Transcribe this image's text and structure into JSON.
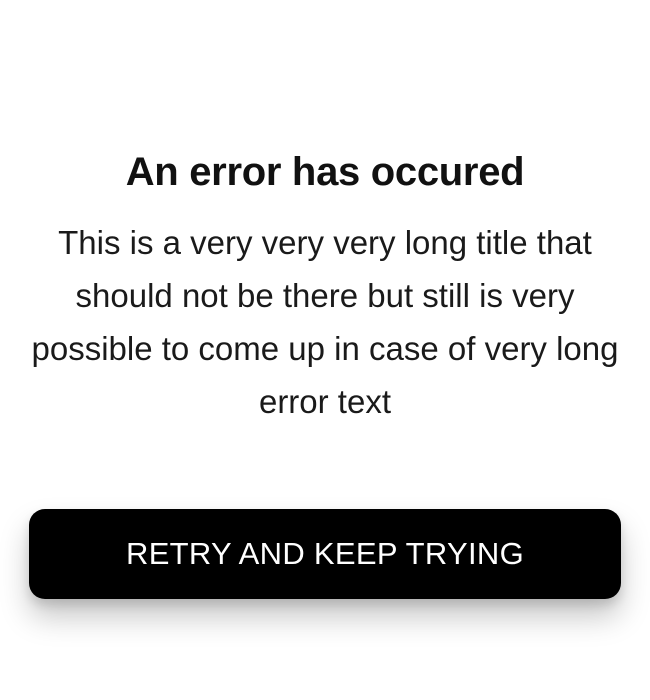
{
  "error": {
    "title": "An error has occured",
    "message": "This is a very very very long title that should not be there but still is very possible to come up in case of very long error text"
  },
  "actions": {
    "retry_label": "RETRY AND KEEP TRYING"
  }
}
